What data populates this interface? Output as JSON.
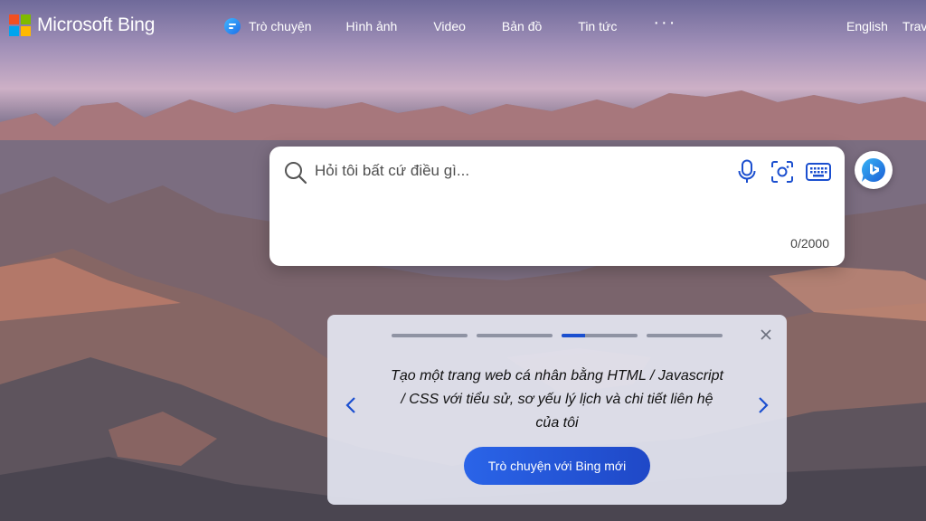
{
  "brand": {
    "name": "Microsoft Bing",
    "tile_colors": [
      "#f25022",
      "#7fba00",
      "#00a4ef",
      "#ffb900"
    ]
  },
  "nav": {
    "chat": "Trò chuyện",
    "images": "Hình ảnh",
    "video": "Video",
    "maps": "Bản đồ",
    "news": "Tin tức",
    "more": "···"
  },
  "header_right": {
    "language": "English",
    "travel": "Trav"
  },
  "search": {
    "placeholder": "Hỏi tôi bất cứ điều gì...",
    "char_count": "0/2000",
    "accent_color": "#1b4fcf"
  },
  "promo": {
    "text": "Tạo một trang web cá nhân bằng HTML / Javascript / CSS với tiểu sử, sơ yếu lý lịch và chi tiết liên hệ của tôi",
    "button": "Trò chuyện với Bing mới",
    "slide_count": 4,
    "active_slide": 3
  },
  "icons": [
    "chat-bubble-icon",
    "search-icon",
    "microphone-icon",
    "visual-search-icon",
    "keyboard-icon",
    "bing-chat-icon",
    "close-icon",
    "chevron-left-icon",
    "chevron-right-icon"
  ]
}
